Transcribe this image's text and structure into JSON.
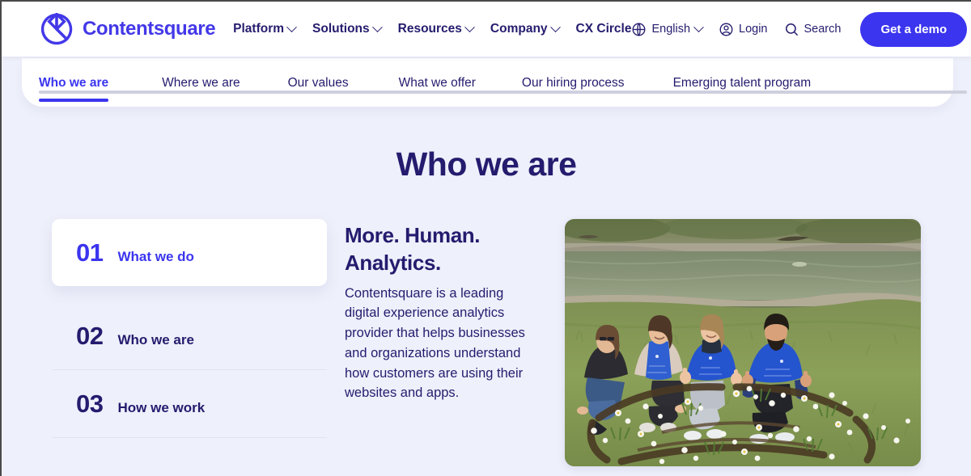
{
  "header": {
    "brand_name": "Contentsquare",
    "brand_logo_icon": "contentsquare-logo-icon",
    "nav": [
      {
        "label": "Platform",
        "has_dropdown": true
      },
      {
        "label": "Solutions",
        "has_dropdown": true
      },
      {
        "label": "Resources",
        "has_dropdown": true
      },
      {
        "label": "Company",
        "has_dropdown": true
      },
      {
        "label": "CX Circle",
        "has_dropdown": false
      }
    ],
    "utilities": [
      {
        "label": "English",
        "icon": "globe-icon",
        "has_dropdown": true
      },
      {
        "label": "Login",
        "icon": "user-circle-icon",
        "has_dropdown": false
      },
      {
        "label": "Search",
        "icon": "search-icon",
        "has_dropdown": false
      }
    ],
    "cta_label": "Get a demo",
    "accent_color": "#3b35ef",
    "brand_color": "#4338e8",
    "text_color": "#241c6e"
  },
  "subnav": {
    "tabs": [
      {
        "label": "Who we are",
        "active": true
      },
      {
        "label": "Where we are",
        "active": false
      },
      {
        "label": "Our values",
        "active": false
      },
      {
        "label": "What we offer",
        "active": false
      },
      {
        "label": "Our hiring process",
        "active": false
      },
      {
        "label": "Emerging talent program",
        "active": false
      }
    ]
  },
  "main": {
    "page_title": "Who we are",
    "accordion": [
      {
        "number": "01",
        "label": "What we do",
        "active": true
      },
      {
        "number": "02",
        "label": "Who we are",
        "active": false
      },
      {
        "number": "03",
        "label": "How we work",
        "active": false
      }
    ],
    "panel": {
      "heading_line_1": "More. Human.",
      "heading_line_2": "Analytics.",
      "body": "Contentsquare is a leading digital experience analytics provider that helps businesses and organizations understand how customers are using their websites and apps.",
      "image_alt": "Four Contentsquare employees in blue team t-shirts kneeling on a grassy riverbank beside a newly planted flower bed"
    }
  },
  "background_color": "#eef0fb"
}
